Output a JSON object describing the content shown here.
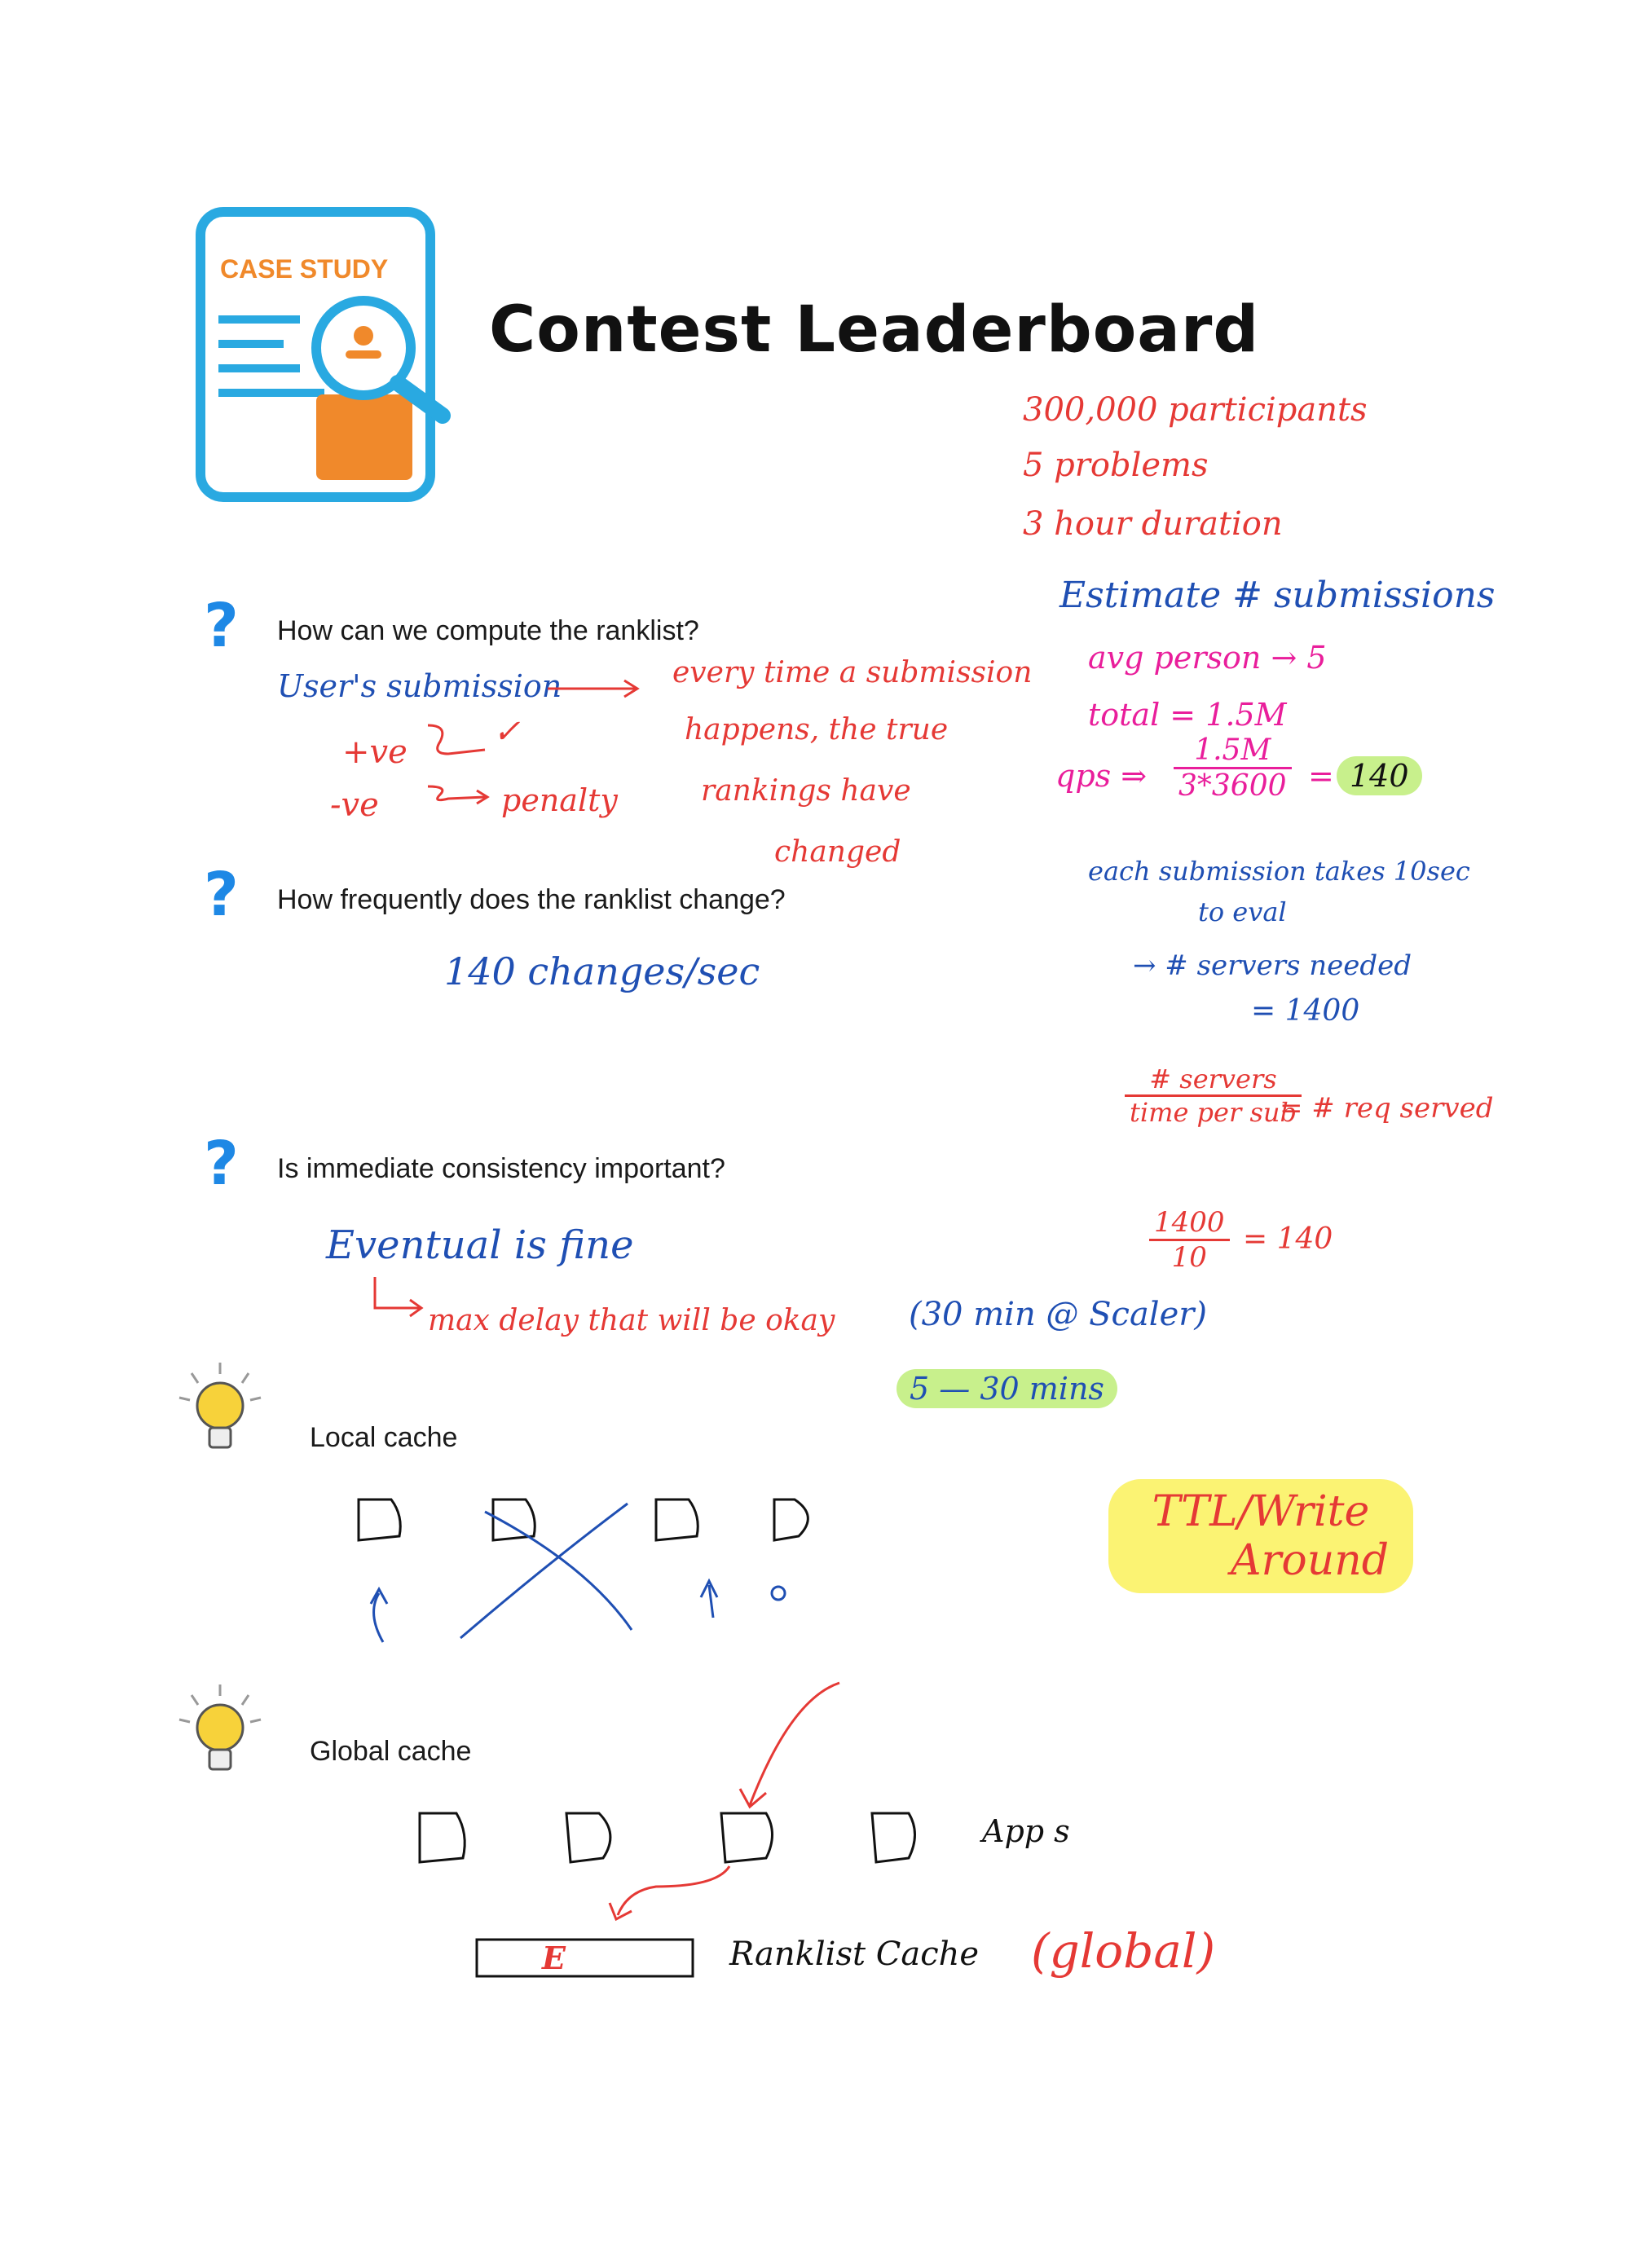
{
  "header": {
    "logo_label": "CASE STUDY",
    "title": "Contest Leaderboard"
  },
  "stats": {
    "participants": "300,000 participants",
    "problems": "5 problems",
    "duration": "3 hour duration"
  },
  "estimate": {
    "heading": "Estimate # submissions",
    "avg": "avg person → 5",
    "total": "total = 1.5M",
    "qps_label": "qps ⇒",
    "qps_num": "1.5M",
    "qps_den": "3*3600",
    "qps_eq": "=",
    "qps_result": "140",
    "eval_line1": "each submission takes 10sec",
    "eval_line2": "to eval",
    "servers_line": "→ # servers needed",
    "servers_value": "= 1400",
    "formula_num": "# servers",
    "formula_den": "time per sub",
    "formula_rhs": "= # req served",
    "calc_num": "1400",
    "calc_den": "10",
    "calc_rhs": "= 140"
  },
  "questions": [
    {
      "mark": "?",
      "text": "How can we compute the ranklist?"
    },
    {
      "mark": "?",
      "text": "How frequently does the ranklist change?"
    },
    {
      "mark": "?",
      "text": "Is immediate consistency important?"
    }
  ],
  "q1_notes": {
    "user_submission": "User's submission",
    "every_time_1": "every time a submission",
    "every_time_2": "happens, the true",
    "every_time_3": "rankings have",
    "every_time_4": "changed",
    "pos": "+ve",
    "neg": "-ve",
    "check": "✓",
    "penalty": "penalty"
  },
  "q2_notes": {
    "changes": "140 changes/sec"
  },
  "q3_notes": {
    "eventual": "Eventual is fine",
    "max_delay": "max delay that will be okay",
    "scaler": "(30 min @ Scaler)",
    "range": "5 — 30 mins"
  },
  "ideas": [
    {
      "label": "Local cache"
    },
    {
      "label": "Global cache"
    }
  ],
  "local_cache": {
    "ttl_1": "TTL/Write",
    "ttl_2": "Around"
  },
  "global_cache": {
    "app": "App s",
    "ranklist_cache": "Ranklist Cache",
    "global": "(global)",
    "cache_mark": "E"
  }
}
